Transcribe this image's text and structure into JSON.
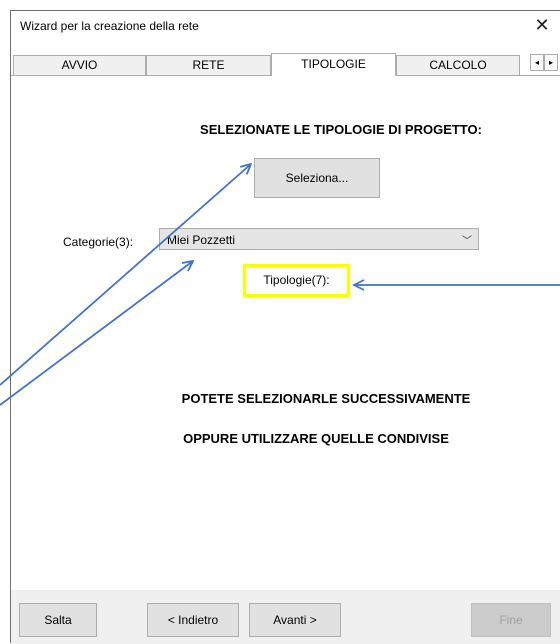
{
  "window": {
    "title": "Wizard per la creazione della rete",
    "close_glyph": "✕"
  },
  "tabs": [
    {
      "label": "AVVIO"
    },
    {
      "label": "RETE"
    },
    {
      "label": "TIPOLOGIE",
      "active": true
    },
    {
      "label": "CALCOLO"
    }
  ],
  "tab_scroll": {
    "left": "◂",
    "right": "▸"
  },
  "content": {
    "heading": "SELEZIONATE LE TIPOLOGIE DI PROGETTO:",
    "select_button": "Seleziona...",
    "category_label": "Categorie(3):",
    "category_value": "Miei Pozzetti",
    "category_chevron": "﹀",
    "tipologie_label": "Tipologie(7):",
    "message_line1": "POTETE SELEZIONARLE SUCCESSIVAMENTE",
    "message_line2": "OPPURE UTILIZZARE QUELLE CONDIVISE"
  },
  "footer": {
    "skip": "Salta",
    "back": "< Indietro",
    "next": "Avanti >",
    "finish": "Fine"
  },
  "colors": {
    "highlight_border": "#ffff00",
    "annotation_arrow": "#4472c4",
    "footer_bg": "#f0f0f0"
  }
}
